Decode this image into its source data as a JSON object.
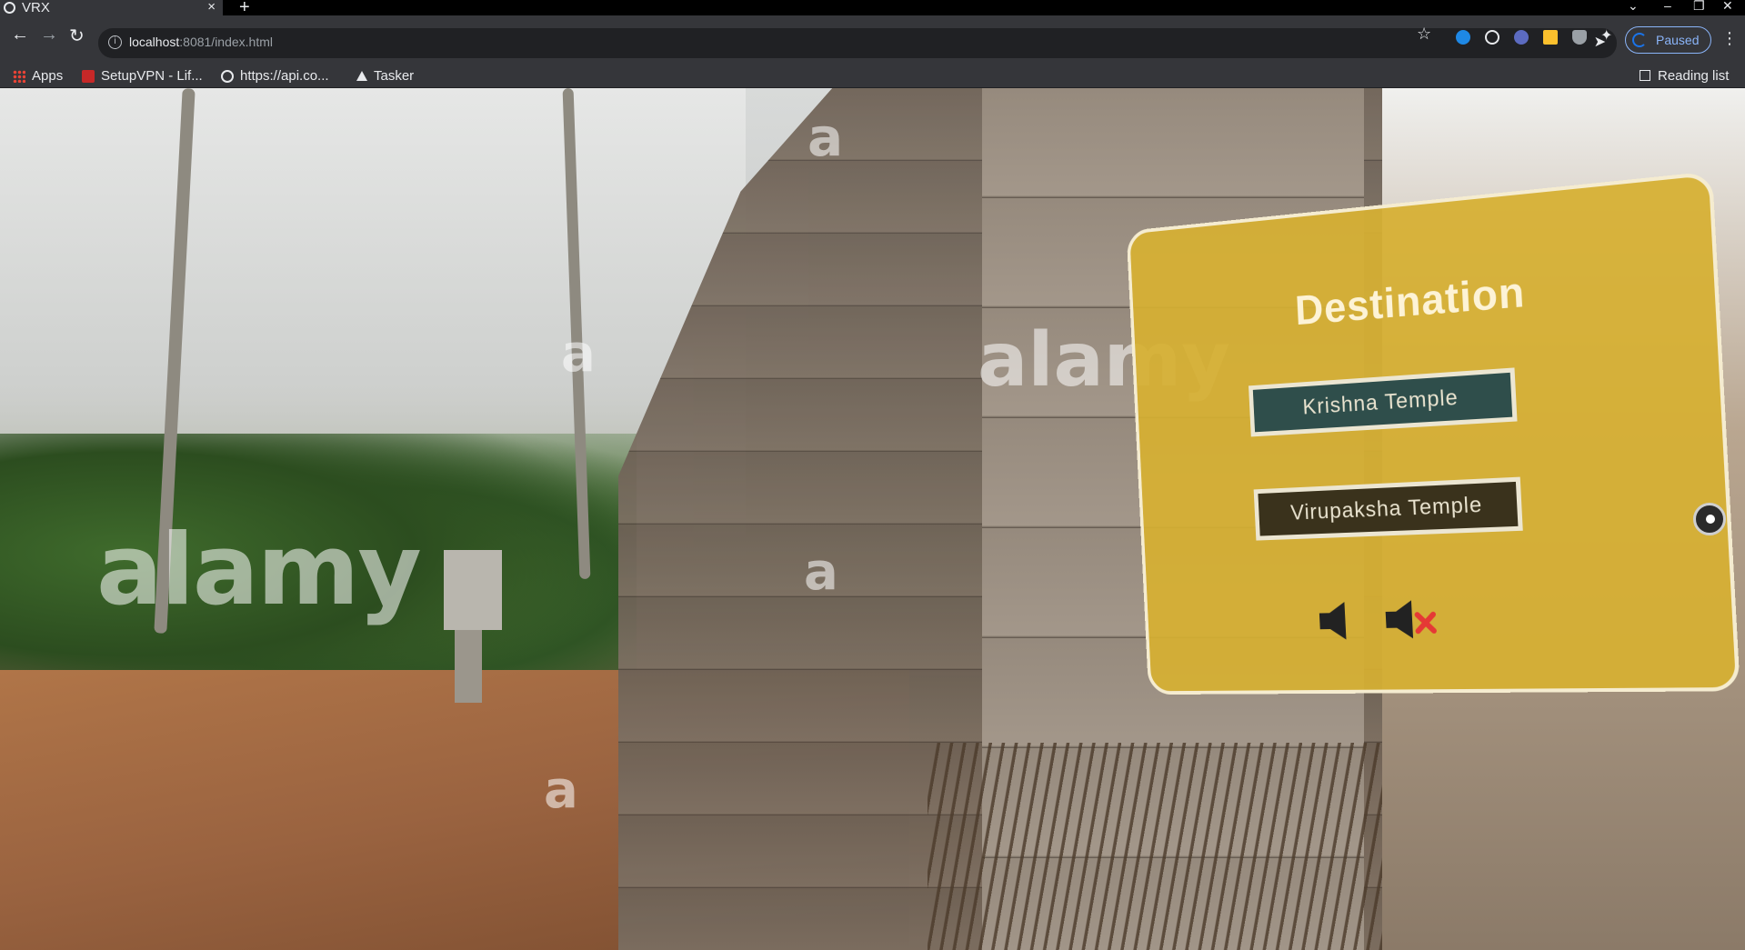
{
  "browser": {
    "tab_title": "VRX",
    "tab_close": "×",
    "new_tab": "+",
    "url_host": "localhost",
    "url_path": ":8081/index.html",
    "profile_status": "Paused",
    "reading_list": "Reading list"
  },
  "bookmarks": [
    {
      "label": "Apps",
      "icon": "apps-grid-icon"
    },
    {
      "label": "SetupVPN - Lif...",
      "icon": "vpn-icon"
    },
    {
      "label": "https://api.co...",
      "icon": "globe-icon"
    },
    {
      "label": "Tasker",
      "icon": "tasker-icon"
    }
  ],
  "scene": {
    "watermarks": [
      "a",
      "alamy",
      "a",
      "a",
      "alamy",
      "a"
    ]
  },
  "panel": {
    "title": "Destination",
    "destinations": [
      {
        "label": "Krishna Temple"
      },
      {
        "label": "Virupaksha Temple"
      }
    ],
    "controls": [
      {
        "name": "sound-on",
        "icon": "speaker-icon"
      },
      {
        "name": "sound-off",
        "icon": "speaker-mute-icon"
      }
    ]
  },
  "colors": {
    "panel_bg": "#d6af32",
    "krishna_btn": "#2f4e4b",
    "virupaksha_btn": "#3a321c",
    "mute_x": "#e53935"
  }
}
